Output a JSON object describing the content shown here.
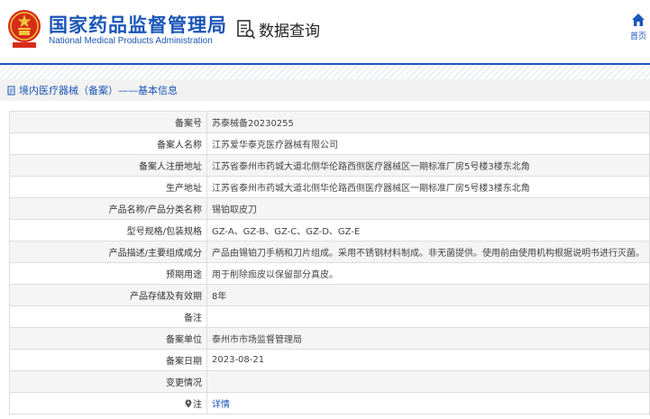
{
  "header": {
    "org_name_cn": "国家药品监督管理局",
    "org_name_en": "National Medical Products Administration",
    "query_label": "数据查询",
    "home_label": "首页"
  },
  "breadcrumb": {
    "text": "境内医疗器械（备案）——基本信息"
  },
  "detail_rows": [
    {
      "label": "备案号",
      "value": "苏泰械备20230255"
    },
    {
      "label": "备案人名称",
      "value": "江苏爱华泰克医疗器械有限公司"
    },
    {
      "label": "备案人注册地址",
      "value": "江苏省泰州市药城大道北侧华伦路西侧医疗器械区一期标准厂房5号楼3楼东北角"
    },
    {
      "label": "生产地址",
      "value": "江苏省泰州市药城大道北侧华伦路西侧医疗器械区一期标准厂房5号楼3楼东北角"
    },
    {
      "label": "产品名称/产品分类名称",
      "value": "锡铂取皮刀"
    },
    {
      "label": "型号规格/包装规格",
      "value": "GZ-A、GZ-B、GZ-C、GZ-D、GZ-E"
    },
    {
      "label": "产品描述/主要组成成分",
      "value": "产品由锡铂刀手柄和刀片组成。采用不锈钢材料制成。非无菌提供。使用前由使用机构根据说明书进行灭菌。"
    },
    {
      "label": "预期用途",
      "value": "用于削除痂皮以保留部分真皮。"
    },
    {
      "label": "产品存储及有效期",
      "value": "8年"
    },
    {
      "label": "备注",
      "value": ""
    },
    {
      "label": "备案单位",
      "value": "泰州市市场监督管理局"
    },
    {
      "label": "备案日期",
      "value": "2023-08-21"
    },
    {
      "label": "变更情况",
      "value": ""
    },
    {
      "label": "注",
      "value": "详情"
    }
  ],
  "colors": {
    "brand_blue": "#1a56b8",
    "emblem_red": "#d62c1a",
    "emblem_gold": "#f3c63a"
  },
  "icons": [
    "emblem-logo",
    "search-document-icon",
    "home-icon",
    "document-icon",
    "location-pin-icon"
  ]
}
